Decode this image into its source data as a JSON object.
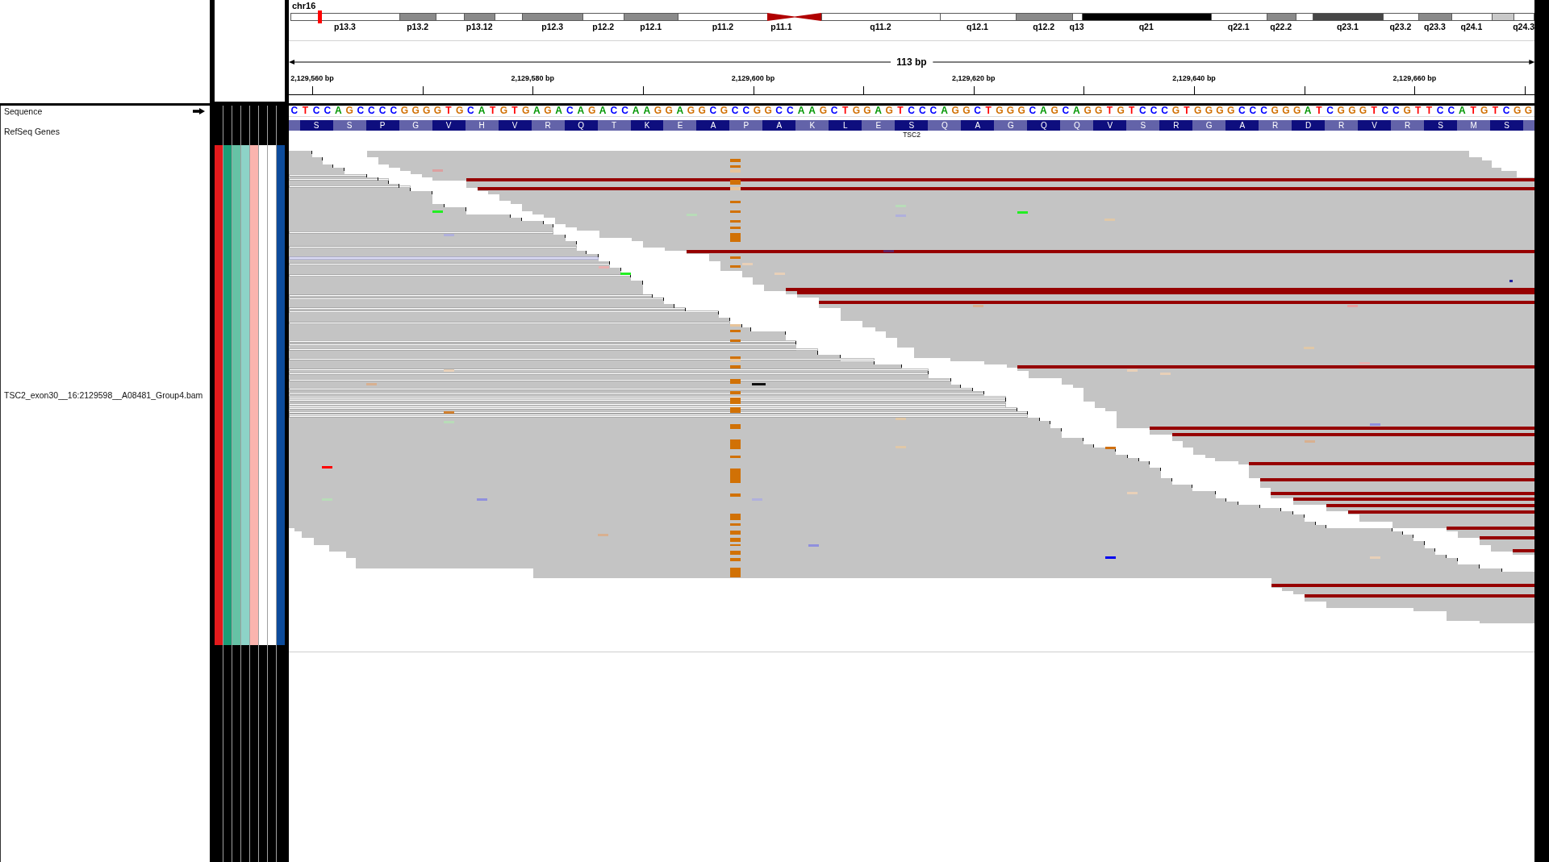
{
  "ideogram": {
    "chromosome": "chr16",
    "bands": [
      {
        "label": "p13.3",
        "kind": "gneg"
      },
      {
        "label": "p13.2",
        "kind": "gpos50"
      },
      {
        "kind": "gneg"
      },
      {
        "label": "p13.12",
        "kind": "gpos50"
      },
      {
        "kind": "gneg"
      },
      {
        "label": "p12.3",
        "kind": "gpos50"
      },
      {
        "label": "p12.2",
        "kind": "gneg"
      },
      {
        "label": "p12.1",
        "kind": "gpos50"
      },
      {
        "label": "p11.2",
        "kind": "gneg"
      },
      {
        "label": "p11.1",
        "kind": "acen"
      },
      {
        "kind": "acen"
      },
      {
        "label": "q11.2",
        "kind": "gneg"
      },
      {
        "label": "q12.1",
        "kind": "gneg"
      },
      {
        "label": "q12.2",
        "kind": "gpos50"
      },
      {
        "label": "q13",
        "kind": "gneg"
      },
      {
        "label": "q21",
        "kind": "gpos100"
      },
      {
        "label": "q22.1",
        "kind": "gneg"
      },
      {
        "label": "q22.2",
        "kind": "gpos50"
      },
      {
        "kind": "gneg"
      },
      {
        "label": "q23.1",
        "kind": "gpos75"
      },
      {
        "label": "q23.2",
        "kind": "gneg"
      },
      {
        "label": "q23.3",
        "kind": "gpos50"
      },
      {
        "label": "q24.1",
        "kind": "gneg"
      },
      {
        "kind": "gpos25"
      },
      {
        "label": "q24.3",
        "kind": "gneg"
      }
    ]
  },
  "ruler": {
    "span": "113 bp",
    "tick_labels": [
      "2,129,560 bp",
      "2,129,580 bp",
      "2,129,600 bp",
      "2,129,620 bp",
      "2,129,640 bp",
      "2,129,660 bp"
    ]
  },
  "tracks": [
    {
      "kind": "sequence",
      "name": "Sequence",
      "strand_forward": true,
      "bases": [
        {
          "base": "C",
          "color": "#0000ff"
        },
        {
          "base": "T",
          "color": "#ff0000"
        },
        {
          "base": "C",
          "color": "#0000ff"
        },
        {
          "base": "C",
          "color": "#0000ff"
        },
        {
          "base": "A",
          "color": "#009600"
        },
        {
          "base": "G",
          "color": "#d17105"
        },
        {
          "base": "C",
          "color": "#0000ff"
        },
        {
          "base": "C",
          "color": "#0000ff"
        },
        {
          "base": "C",
          "color": "#0000ff"
        },
        {
          "base": "C",
          "color": "#0000ff"
        },
        {
          "base": "G",
          "color": "#d17105"
        },
        {
          "base": "G",
          "color": "#d17105"
        },
        {
          "base": "G",
          "color": "#d17105"
        },
        {
          "base": "G",
          "color": "#d17105"
        },
        {
          "base": "T",
          "color": "#ff0000"
        },
        {
          "base": "G",
          "color": "#d17105"
        },
        {
          "base": "C",
          "color": "#0000ff"
        },
        {
          "base": "A",
          "color": "#009600"
        },
        {
          "base": "T",
          "color": "#ff0000"
        },
        {
          "base": "G",
          "color": "#d17105"
        },
        {
          "base": "T",
          "color": "#ff0000"
        },
        {
          "base": "G",
          "color": "#d17105"
        },
        {
          "base": "A",
          "color": "#009600"
        },
        {
          "base": "G",
          "color": "#d17105"
        },
        {
          "base": "A",
          "color": "#009600"
        },
        {
          "base": "C",
          "color": "#0000ff"
        },
        {
          "base": "A",
          "color": "#009600"
        },
        {
          "base": "G",
          "color": "#d17105"
        },
        {
          "base": "A",
          "color": "#009600"
        },
        {
          "base": "C",
          "color": "#0000ff"
        },
        {
          "base": "C",
          "color": "#0000ff"
        },
        {
          "base": "A",
          "color": "#009600"
        },
        {
          "base": "A",
          "color": "#009600"
        },
        {
          "base": "G",
          "color": "#d17105"
        },
        {
          "base": "G",
          "color": "#d17105"
        },
        {
          "base": "A",
          "color": "#009600"
        },
        {
          "base": "G",
          "color": "#d17105"
        },
        {
          "base": "G",
          "color": "#d17105"
        },
        {
          "base": "C",
          "color": "#0000ff"
        },
        {
          "base": "G",
          "color": "#d17105"
        },
        {
          "base": "C",
          "color": "#0000ff"
        },
        {
          "base": "C",
          "color": "#0000ff"
        },
        {
          "base": "G",
          "color": "#d17105"
        },
        {
          "base": "G",
          "color": "#d17105"
        },
        {
          "base": "C",
          "color": "#0000ff"
        },
        {
          "base": "C",
          "color": "#0000ff"
        },
        {
          "base": "A",
          "color": "#009600"
        },
        {
          "base": "A",
          "color": "#009600"
        },
        {
          "base": "G",
          "color": "#d17105"
        },
        {
          "base": "C",
          "color": "#0000ff"
        },
        {
          "base": "T",
          "color": "#ff0000"
        },
        {
          "base": "G",
          "color": "#d17105"
        },
        {
          "base": "G",
          "color": "#d17105"
        },
        {
          "base": "A",
          "color": "#009600"
        },
        {
          "base": "G",
          "color": "#d17105"
        },
        {
          "base": "T",
          "color": "#ff0000"
        },
        {
          "base": "C",
          "color": "#0000ff"
        },
        {
          "base": "C",
          "color": "#0000ff"
        },
        {
          "base": "C",
          "color": "#0000ff"
        },
        {
          "base": "A",
          "color": "#009600"
        },
        {
          "base": "G",
          "color": "#d17105"
        },
        {
          "base": "G",
          "color": "#d17105"
        },
        {
          "base": "C",
          "color": "#0000ff"
        },
        {
          "base": "T",
          "color": "#ff0000"
        },
        {
          "base": "G",
          "color": "#d17105"
        },
        {
          "base": "G",
          "color": "#d17105"
        },
        {
          "base": "G",
          "color": "#d17105"
        },
        {
          "base": "C",
          "color": "#0000ff"
        },
        {
          "base": "A",
          "color": "#009600"
        },
        {
          "base": "G",
          "color": "#d17105"
        },
        {
          "base": "C",
          "color": "#0000ff"
        },
        {
          "base": "A",
          "color": "#009600"
        },
        {
          "base": "G",
          "color": "#d17105"
        },
        {
          "base": "G",
          "color": "#d17105"
        },
        {
          "base": "T",
          "color": "#ff0000"
        },
        {
          "base": "G",
          "color": "#d17105"
        },
        {
          "base": "T",
          "color": "#ff0000"
        },
        {
          "base": "C",
          "color": "#0000ff"
        },
        {
          "base": "C",
          "color": "#0000ff"
        },
        {
          "base": "C",
          "color": "#0000ff"
        },
        {
          "base": "G",
          "color": "#d17105"
        },
        {
          "base": "T",
          "color": "#ff0000"
        },
        {
          "base": "G",
          "color": "#d17105"
        },
        {
          "base": "G",
          "color": "#d17105"
        },
        {
          "base": "G",
          "color": "#d17105"
        },
        {
          "base": "G",
          "color": "#d17105"
        },
        {
          "base": "C",
          "color": "#0000ff"
        },
        {
          "base": "C",
          "color": "#0000ff"
        },
        {
          "base": "C",
          "color": "#0000ff"
        },
        {
          "base": "G",
          "color": "#d17105"
        },
        {
          "base": "G",
          "color": "#d17105"
        },
        {
          "base": "G",
          "color": "#d17105"
        },
        {
          "base": "A",
          "color": "#009600"
        },
        {
          "base": "T",
          "color": "#ff0000"
        },
        {
          "base": "C",
          "color": "#0000ff"
        },
        {
          "base": "G",
          "color": "#d17105"
        },
        {
          "base": "G",
          "color": "#d17105"
        },
        {
          "base": "G",
          "color": "#d17105"
        },
        {
          "base": "T",
          "color": "#ff0000"
        },
        {
          "base": "C",
          "color": "#0000ff"
        },
        {
          "base": "C",
          "color": "#0000ff"
        },
        {
          "base": "G",
          "color": "#d17105"
        },
        {
          "base": "T",
          "color": "#ff0000"
        },
        {
          "base": "T",
          "color": "#ff0000"
        },
        {
          "base": "C",
          "color": "#0000ff"
        },
        {
          "base": "C",
          "color": "#0000ff"
        },
        {
          "base": "A",
          "color": "#009600"
        },
        {
          "base": "T",
          "color": "#ff0000"
        },
        {
          "base": "G",
          "color": "#d17105"
        },
        {
          "base": "T",
          "color": "#ff0000"
        },
        {
          "base": "C",
          "color": "#0000ff"
        },
        {
          "base": "G",
          "color": "#d17105"
        },
        {
          "base": "G",
          "color": "#d17105"
        }
      ]
    },
    {
      "kind": "gene",
      "name": "RefSeq Genes",
      "gene": "TSC2",
      "amino_acids": [
        "S",
        "S",
        "P",
        "G",
        "V",
        "H",
        "V",
        "R",
        "Q",
        "T",
        "K",
        "E",
        "A",
        "P",
        "A",
        "K",
        "L",
        "E",
        "S",
        "Q",
        "A",
        "G",
        "Q",
        "Q",
        "V",
        "S",
        "R",
        "G",
        "A",
        "R",
        "D",
        "R",
        "V",
        "R",
        "S",
        "M",
        "S"
      ]
    },
    {
      "kind": "alignment",
      "name": "TSC2_exon30__16:2129598__A08481_Group4.bam",
      "attributes": [
        {
          "color": "#e31a1c"
        },
        {
          "color": "#1b9e77"
        },
        {
          "color": "#66c2a5"
        },
        {
          "color": "#8dd3c7"
        },
        {
          "color": "#fbb4ae"
        },
        {
          "color": "#ffffff"
        },
        {
          "color": "#ffffff"
        },
        {
          "color": "#0c4b9b"
        }
      ]
    }
  ]
}
